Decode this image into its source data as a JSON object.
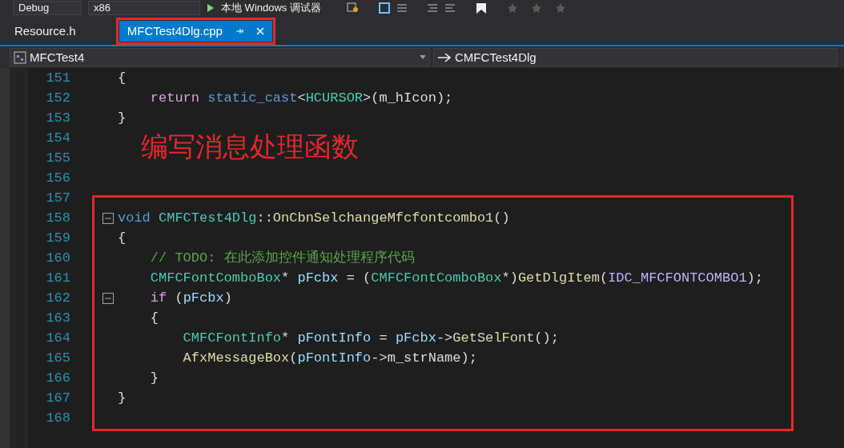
{
  "toolbar": {
    "configuration": "Debug",
    "platform": "x86",
    "run_label": "本地 Windows 调试器"
  },
  "tabs": [
    {
      "label": "Resource.h",
      "selected": false,
      "highlighted": false
    },
    {
      "label": "MFCTest4Dlg.cpp",
      "selected": true,
      "highlighted": true
    }
  ],
  "navigation": {
    "project": "MFCTest4",
    "class": "CMFCTest4Dlg"
  },
  "code_lines": [
    {
      "number": "151",
      "foldable": false,
      "tokens": [
        {
          "kind": "plain",
          "text": "{"
        }
      ]
    },
    {
      "number": "152",
      "foldable": false,
      "tokens": [
        {
          "kind": "control",
          "text": "    return "
        },
        {
          "kind": "keyword",
          "text": "static_cast"
        },
        {
          "kind": "plain",
          "text": "<"
        },
        {
          "kind": "type",
          "text": "HCURSOR"
        },
        {
          "kind": "plain",
          "text": ">(m_hIcon);"
        }
      ]
    },
    {
      "number": "153",
      "foldable": false,
      "tokens": [
        {
          "kind": "plain",
          "text": "}"
        }
      ]
    },
    {
      "number": "154",
      "foldable": false
    },
    {
      "number": "155",
      "foldable": false
    },
    {
      "number": "156",
      "foldable": false
    },
    {
      "number": "157",
      "foldable": false
    }
  ],
  "highlighted_block": {
    "lines": [
      {
        "number": "158",
        "foldable": true,
        "tokens": [
          {
            "kind": "keyword",
            "text": "void "
          },
          {
            "kind": "type",
            "text": "CMFCTest4Dlg"
          },
          {
            "kind": "plain",
            "text": "::"
          },
          {
            "kind": "function",
            "text": "OnCbnSelchangeMfcfontcombo1"
          },
          {
            "kind": "plain",
            "text": "()"
          }
        ]
      },
      {
        "number": "159",
        "foldable": false,
        "tokens": [
          {
            "kind": "plain",
            "text": "{"
          }
        ]
      },
      {
        "number": "160",
        "foldable": false,
        "tokens": [
          {
            "kind": "comment",
            "text": "    // TODO: 在此添加控件通知处理程序代码"
          }
        ]
      },
      {
        "number": "161",
        "foldable": false,
        "tokens": [
          {
            "kind": "type",
            "text": "    CMFCFontComboBox"
          },
          {
            "kind": "plain",
            "text": "* "
          },
          {
            "kind": "variable",
            "text": "pFcbx"
          },
          {
            "kind": "plain",
            "text": " = ("
          },
          {
            "kind": "type",
            "text": "CMFCFontComboBox"
          },
          {
            "kind": "plain",
            "text": "*)"
          },
          {
            "kind": "function",
            "text": "GetDlgItem"
          },
          {
            "kind": "plain",
            "text": "("
          },
          {
            "kind": "macro",
            "text": "IDC_MFCFONTCOMBO1"
          },
          {
            "kind": "plain",
            "text": ");"
          }
        ]
      },
      {
        "number": "162",
        "foldable": true,
        "tokens": [
          {
            "kind": "control",
            "text": "    if"
          },
          {
            "kind": "plain",
            "text": " ("
          },
          {
            "kind": "variable",
            "text": "pFcbx"
          },
          {
            "kind": "plain",
            "text": ")"
          }
        ]
      },
      {
        "number": "163",
        "foldable": false,
        "tokens": [
          {
            "kind": "plain",
            "text": "    {"
          }
        ]
      },
      {
        "number": "164",
        "foldable": false,
        "tokens": [
          {
            "kind": "type",
            "text": "        CMFCFontInfo"
          },
          {
            "kind": "plain",
            "text": "* "
          },
          {
            "kind": "variable",
            "text": "pFontInfo"
          },
          {
            "kind": "plain",
            "text": " = "
          },
          {
            "kind": "variable",
            "text": "pFcbx"
          },
          {
            "kind": "plain",
            "text": "->"
          },
          {
            "kind": "function",
            "text": "GetSelFont"
          },
          {
            "kind": "plain",
            "text": "();"
          }
        ]
      },
      {
        "number": "165",
        "foldable": false,
        "tokens": [
          {
            "kind": "function",
            "text": "        AfxMessageBox"
          },
          {
            "kind": "plain",
            "text": "("
          },
          {
            "kind": "variable",
            "text": "pFontInfo"
          },
          {
            "kind": "plain",
            "text": "->m_strName);"
          }
        ]
      },
      {
        "number": "166",
        "foldable": false,
        "tokens": [
          {
            "kind": "plain",
            "text": "    }"
          }
        ]
      },
      {
        "number": "167",
        "foldable": false,
        "tokens": [
          {
            "kind": "plain",
            "text": "}"
          }
        ]
      },
      {
        "number": "168",
        "foldable": false
      }
    ]
  },
  "annotation": {
    "text": "编写消息处理函数"
  }
}
